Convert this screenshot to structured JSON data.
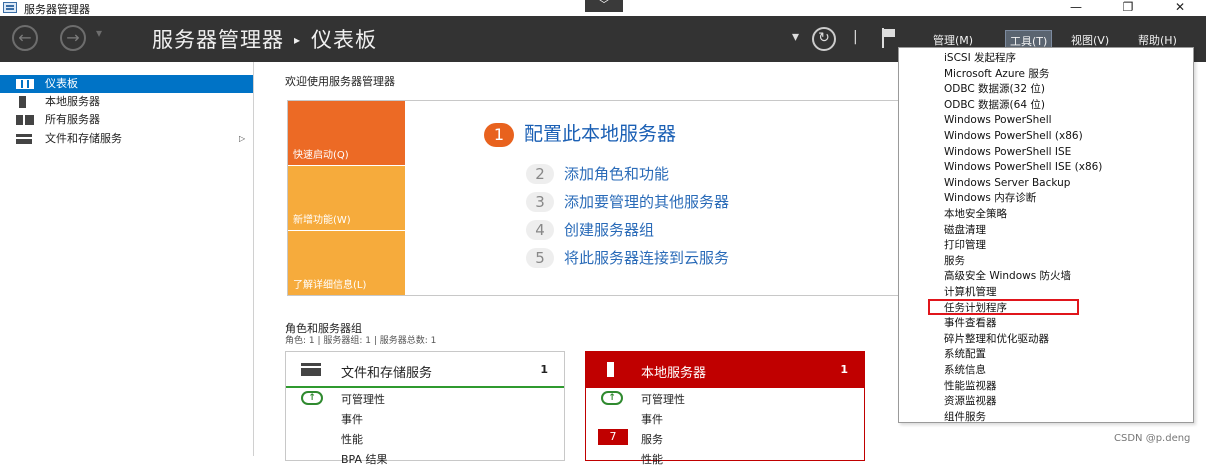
{
  "window": {
    "title": "服务器管理器",
    "center_button": "﹀",
    "minimize": "—",
    "maximize": "❐",
    "close": "✕"
  },
  "header": {
    "back_glyph": "←",
    "forward_glyph": "→",
    "nav_dropdown_glyph": "▾",
    "breadcrumb": [
      "服务器管理器",
      "仪表板"
    ],
    "breadcrumb_sep": "▸",
    "hdr_dropdown_glyph": "▾",
    "refresh_glyph": "↻",
    "divider": "|",
    "menus": [
      "管理(M)",
      "工具(T)",
      "视图(V)",
      "帮助(H)"
    ],
    "active_menu": "工具(T)"
  },
  "sidebar": {
    "items": [
      {
        "label": "仪表板",
        "icon": "dashboard-icon",
        "selected": true
      },
      {
        "label": "本地服务器",
        "icon": "server-icon"
      },
      {
        "label": "所有服务器",
        "icon": "servers-icon"
      },
      {
        "label": "文件和存储服务",
        "icon": "storage-icon",
        "arrow": "▷"
      }
    ]
  },
  "main": {
    "welcome_title": "欢迎使用服务器管理器",
    "tiles": [
      "快速启动(Q)",
      "新增功能(W)",
      "了解详细信息(L)"
    ],
    "step1": {
      "num": "1",
      "label": "配置此本地服务器"
    },
    "steps": [
      {
        "num": "2",
        "label": "添加角色和功能"
      },
      {
        "num": "3",
        "label": "添加要管理的其他服务器"
      },
      {
        "num": "4",
        "label": "创建服务器组"
      },
      {
        "num": "5",
        "label": "将此服务器连接到云服务"
      }
    ],
    "roles_title": "角色和服务器组",
    "roles_subtitle": "角色: 1 | 服务器组: 1 | 服务器总数: 1",
    "cards": [
      {
        "title": "文件和存储服务",
        "count": "1",
        "rows": [
          "可管理性",
          "事件",
          "性能",
          "BPA 结果"
        ]
      },
      {
        "title": "本地服务器",
        "count": "1",
        "rows": [
          "可管理性",
          "事件",
          "服务",
          "性能"
        ],
        "badge": "7"
      }
    ]
  },
  "tools_menu": {
    "items": [
      "iSCSI 发起程序",
      "Microsoft Azure 服务",
      "ODBC 数据源(32 位)",
      "ODBC 数据源(64 位)",
      "Windows PowerShell",
      "Windows PowerShell (x86)",
      "Windows PowerShell ISE",
      "Windows PowerShell ISE (x86)",
      "Windows Server Backup",
      "Windows 内存诊断",
      "本地安全策略",
      "磁盘清理",
      "打印管理",
      "服务",
      "高级安全 Windows 防火墙",
      "计算机管理",
      "任务计划程序",
      "事件查看器",
      "碎片整理和优化驱动器",
      "系统配置",
      "系统信息",
      "性能监视器",
      "资源监视器",
      "组件服务"
    ],
    "highlighted": "任务计划程序",
    "highlight_color": "#e0151b"
  },
  "watermark": "CSDN @p.deng",
  "colors": {
    "header": "#333333",
    "accent": "#0073c6",
    "orange": "#ec6a25",
    "tile": "#f6ab3c",
    "red": "#c00000",
    "green": "#2f9a2f"
  }
}
